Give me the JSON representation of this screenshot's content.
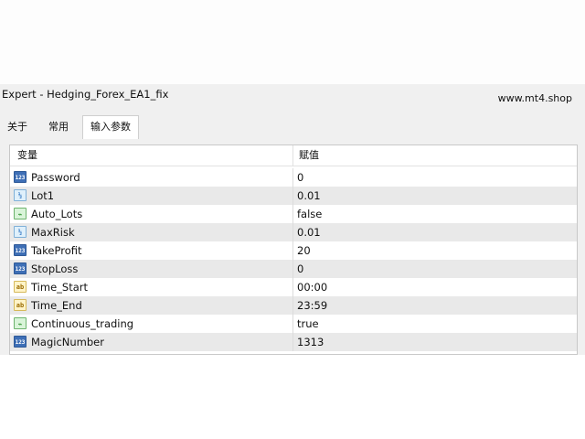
{
  "window": {
    "title": "Expert - Hedging_Forex_EA1_fix",
    "watermark": "www.mt4.shop"
  },
  "tabs": [
    {
      "label": "关于",
      "active": false
    },
    {
      "label": "常用",
      "active": false
    },
    {
      "label": "输入参数",
      "active": true
    }
  ],
  "grid": {
    "columns": {
      "variable": "变量",
      "value": "赋值"
    },
    "rows": [
      {
        "name": "Password",
        "value": "0",
        "type_icon": "int-icon",
        "icon_text": "123"
      },
      {
        "name": "Lot1",
        "value": "0.01",
        "type_icon": "double-icon",
        "icon_text": "½"
      },
      {
        "name": "Auto_Lots",
        "value": "false",
        "type_icon": "bool-icon",
        "icon_text": "⌁"
      },
      {
        "name": "MaxRisk",
        "value": "0.01",
        "type_icon": "double-icon",
        "icon_text": "½"
      },
      {
        "name": "TakeProfit",
        "value": "20",
        "type_icon": "int-icon",
        "icon_text": "123"
      },
      {
        "name": "StopLoss",
        "value": "0",
        "type_icon": "int-icon",
        "icon_text": "123"
      },
      {
        "name": "Time_Start",
        "value": "00:00",
        "type_icon": "string-icon",
        "icon_text": "ab"
      },
      {
        "name": "Time_End",
        "value": "23:59",
        "type_icon": "string-icon",
        "icon_text": "ab"
      },
      {
        "name": "Continuous_trading",
        "value": "true",
        "type_icon": "bool-icon",
        "icon_text": "⌁"
      },
      {
        "name": "MagicNumber",
        "value": "1313",
        "type_icon": "int-icon",
        "icon_text": "123"
      }
    ]
  }
}
